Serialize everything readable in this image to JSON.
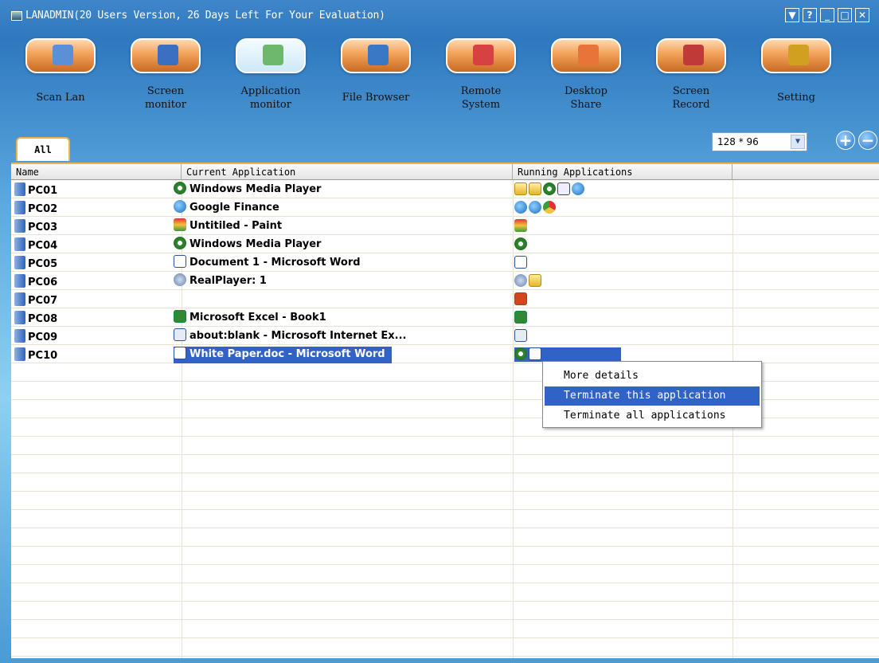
{
  "window": {
    "title": "LANADMIN(20 Users Version, 26 Days Left For Your Evaluation)",
    "controls": [
      "▼",
      "?",
      "_",
      "□",
      "✕"
    ]
  },
  "toolbar": {
    "items": [
      {
        "label": "Scan Lan",
        "icon": "scan-lan-icon",
        "active": false
      },
      {
        "label": "Screen\nmonitor",
        "icon": "screen-monitor-icon",
        "active": false
      },
      {
        "label": "Application\nmonitor",
        "icon": "application-monitor-icon",
        "active": true
      },
      {
        "label": "File Browser",
        "icon": "file-browser-icon",
        "active": false
      },
      {
        "label": "Remote\nSystem",
        "icon": "remote-system-icon",
        "active": false
      },
      {
        "label": "Desktop\nShare",
        "icon": "desktop-share-icon",
        "active": false
      },
      {
        "label": "Screen\nRecord",
        "icon": "screen-record-icon",
        "active": false
      },
      {
        "label": "Setting",
        "icon": "setting-icon",
        "active": false
      }
    ]
  },
  "tabs": {
    "all_label": "All"
  },
  "zoom": {
    "value": "128 * 96",
    "plus": "+",
    "minus": "−"
  },
  "grid": {
    "columns": [
      "Name",
      "Current Application",
      "Running Applications"
    ],
    "rows": [
      {
        "name": "PC01",
        "app": "Windows Media Player",
        "app_icon": "i-wmp",
        "running": [
          "i-folder",
          "i-folder",
          "i-wmp",
          "i-media",
          "i-ie"
        ]
      },
      {
        "name": "PC02",
        "app": "Google Finance",
        "app_icon": "i-ie",
        "running": [
          "i-ie",
          "i-ie",
          "i-chrome"
        ]
      },
      {
        "name": "PC03",
        "app": "Untitiled - Paint",
        "app_icon": "i-paint",
        "running": [
          "i-paint"
        ]
      },
      {
        "name": "PC04",
        "app": "Windows Media Player",
        "app_icon": "i-wmp",
        "running": [
          "i-wmp"
        ]
      },
      {
        "name": "PC05",
        "app": "Document 1 - Microsoft Word",
        "app_icon": "i-word",
        "running": [
          "i-word"
        ]
      },
      {
        "name": "PC06",
        "app": "RealPlayer: 1",
        "app_icon": "i-real",
        "running": [
          "i-real",
          "i-folder"
        ]
      },
      {
        "name": "PC07",
        "app": "",
        "app_icon": "",
        "running": [
          "i-ppt"
        ]
      },
      {
        "name": "PC08",
        "app": "Microsoft Excel - Book1",
        "app_icon": "i-excel",
        "running": [
          "i-excel"
        ]
      },
      {
        "name": "PC09",
        "app": "about:blank - Microsoft Internet Ex...",
        "app_icon": "i-blank",
        "running": [
          "i-blank"
        ]
      },
      {
        "name": "PC10",
        "app": "White Paper.doc - Microsoft Word",
        "app_icon": "i-word",
        "running": [
          "i-wmp",
          "i-word"
        ],
        "selected": true
      }
    ]
  },
  "context_menu": {
    "items": [
      {
        "label": "More details",
        "highlighted": false
      },
      {
        "label": "Terminate this application",
        "highlighted": true
      },
      {
        "label": "Terminate all applications",
        "highlighted": false
      }
    ]
  },
  "colors": {
    "selection": "#3163c6",
    "tab_border": "#f0b34a",
    "toolbar_button": "#f2a058"
  }
}
